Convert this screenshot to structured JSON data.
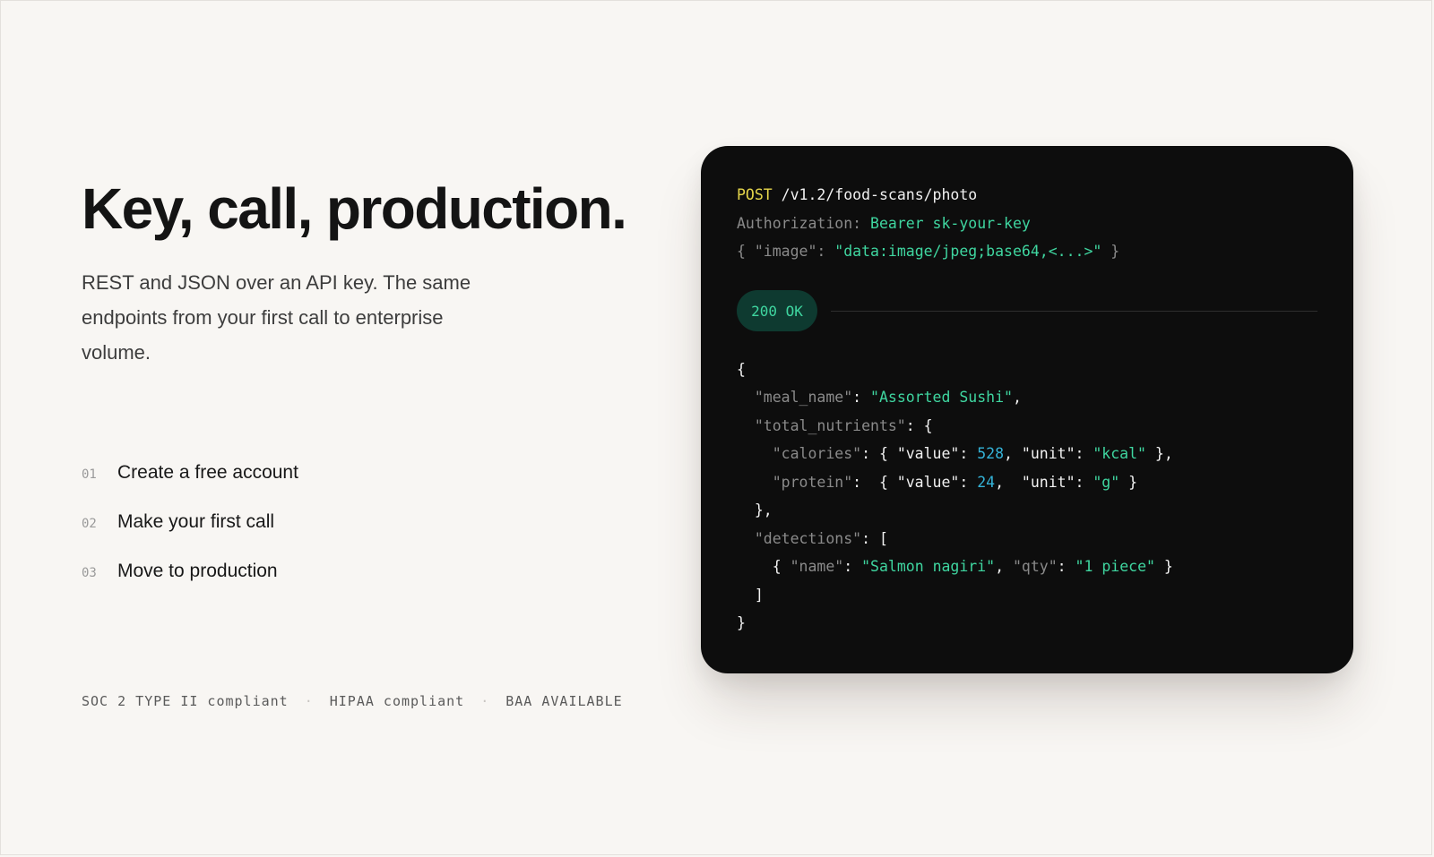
{
  "hero": {
    "title": "Key, call, production.",
    "lede": "REST and JSON over an API key. The same endpoints from your first call to enterprise volume."
  },
  "steps": [
    {
      "num": "01",
      "label": "Create a free account"
    },
    {
      "num": "02",
      "label": "Make your first call"
    },
    {
      "num": "03",
      "label": "Move to production"
    }
  ],
  "compliance": [
    "SOC 2 TYPE II compliant",
    "HIPAA compliant",
    "BAA AVAILABLE"
  ],
  "code": {
    "method": "POST",
    "path": " /v1.2/food-scans/photo",
    "auth_key": "Authorization: ",
    "auth_val": "Bearer sk-your-key",
    "body_open": "{ ",
    "body_key": "\"image\"",
    "body_colon": ": ",
    "body_val": "\"data:image/jpeg;base64,<...>\"",
    "body_close": " }",
    "status": "200 OK",
    "resp": {
      "l1": "{",
      "l2_key": "  \"meal_name\"",
      "l2_colon": ": ",
      "l2_val": "\"Assorted Sushi\"",
      "l2_end": ",",
      "l3_key": "  \"total_nutrients\"",
      "l3_rest": ": {",
      "l4_key": "    \"calories\"",
      "l4_a": ": { \"value\": ",
      "l4_num": "528",
      "l4_b": ", \"unit\": ",
      "l4_str": "\"kcal\"",
      "l4_c": " },",
      "l5_key": "    \"protein\"",
      "l5_a": ":  { \"value\": ",
      "l5_num": "24",
      "l5_b": ",  \"unit\": ",
      "l5_str": "\"g\"",
      "l5_c": " }",
      "l6": "  },",
      "l7_key": "  \"detections\"",
      "l7_rest": ": [",
      "l8_a": "    { ",
      "l8_key1": "\"name\"",
      "l8_colon1": ": ",
      "l8_val1": "\"Salmon nagiri\"",
      "l8_sep": ", ",
      "l8_key2": "\"qty\"",
      "l8_colon2": ": ",
      "l8_val2": "\"1 piece\"",
      "l8_c": " }",
      "l9": "  ]",
      "l10": "}"
    }
  }
}
